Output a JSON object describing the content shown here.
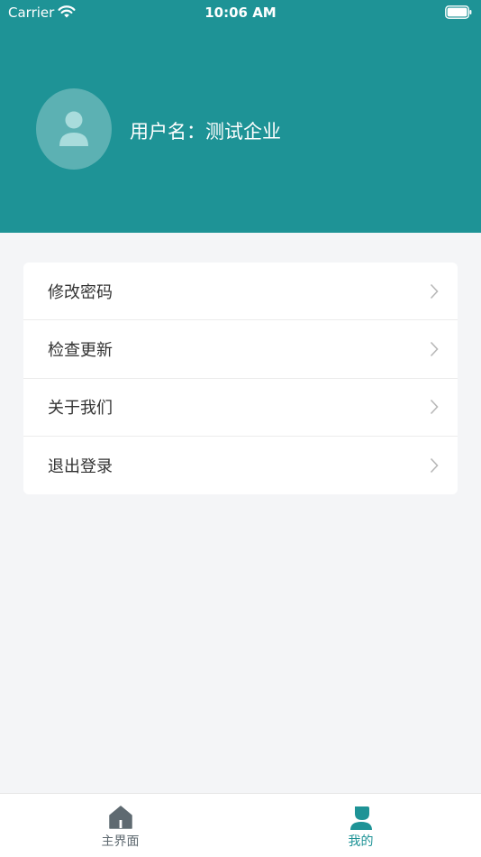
{
  "status_bar": {
    "carrier": "Carrier",
    "time": "10:06 AM"
  },
  "profile": {
    "username": "用户名：测试企业"
  },
  "menu": {
    "items": [
      {
        "label": "修改密码"
      },
      {
        "label": "检查更新"
      },
      {
        "label": "关于我们"
      },
      {
        "label": "退出登录"
      }
    ]
  },
  "tab_bar": {
    "tabs": [
      {
        "label": "主界面",
        "icon": "home-icon",
        "selected": false
      },
      {
        "label": "我的",
        "icon": "user-icon",
        "selected": true
      }
    ]
  },
  "colors": {
    "header": "#1e9396",
    "accent": "#1e9396",
    "tab_inactive": "#5f6a71"
  }
}
